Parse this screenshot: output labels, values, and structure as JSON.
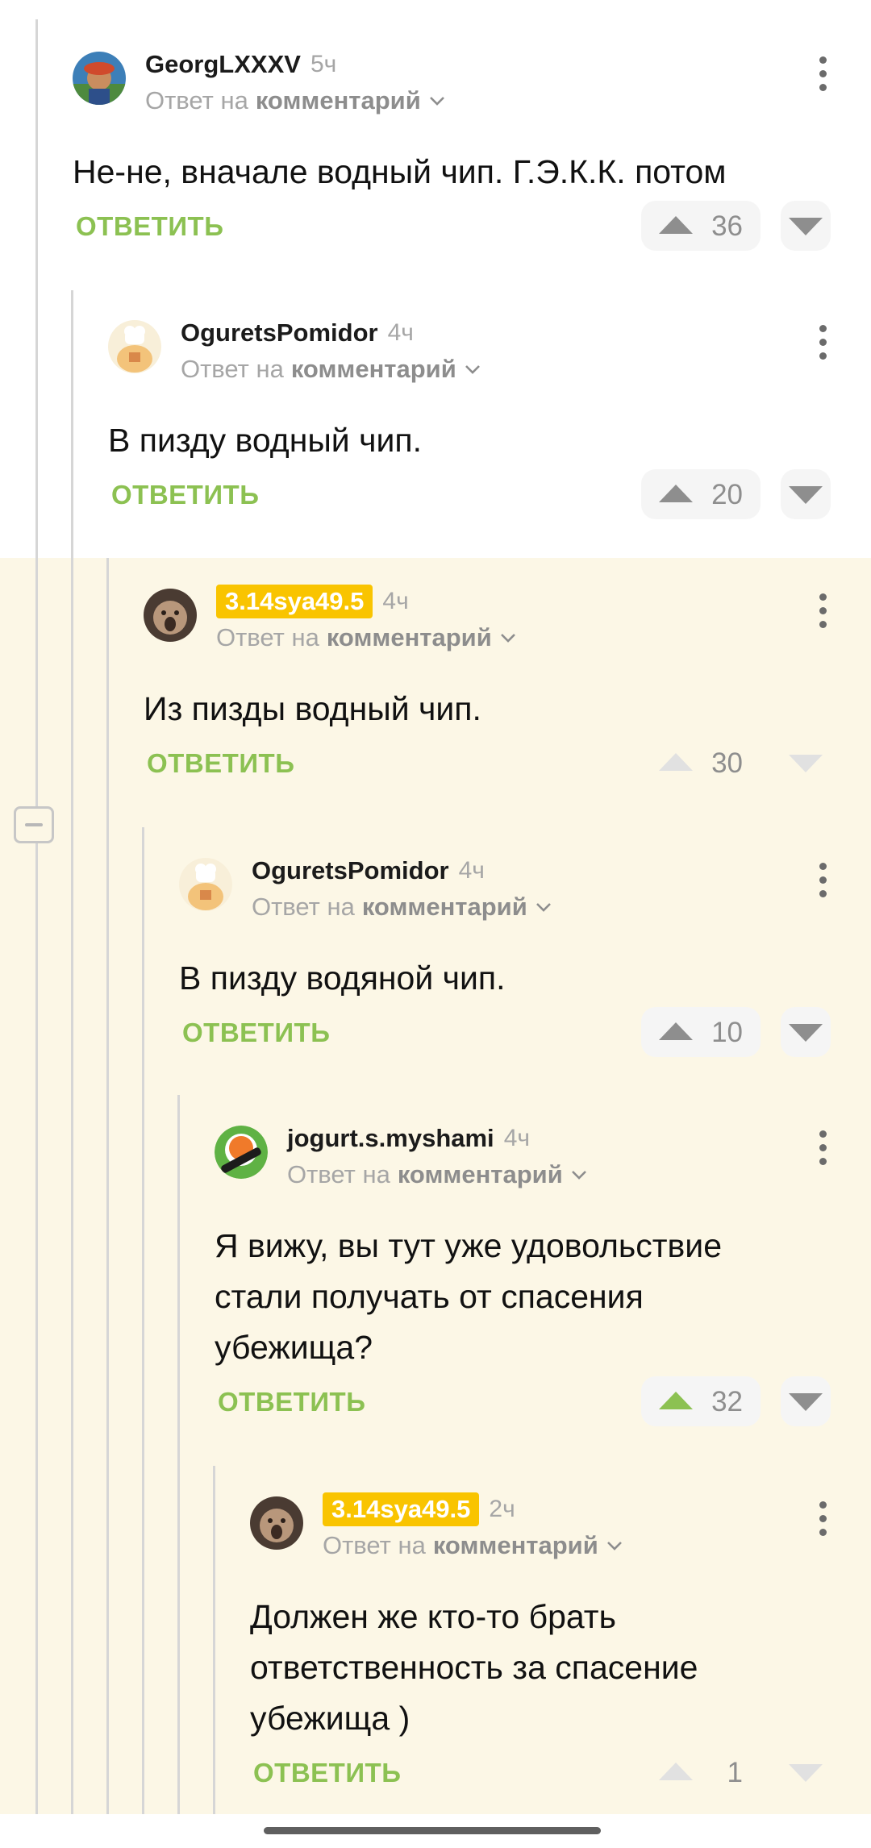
{
  "reply_prefix": "Ответ на",
  "reply_target": "комментарий",
  "reply_action": "ОТВЕТИТЬ",
  "comments": [
    {
      "user": "GeorgLXXXV",
      "time": "5ч",
      "text": "Не-не, вначале водный чип. Г.Э.К.К. потом",
      "votes": "36",
      "avatar": "photo-avatar-hat"
    },
    {
      "user": "OguretsPomidor",
      "time": "4ч",
      "text": "В пизду водный чип.",
      "votes": "20",
      "avatar": "chef-avatar"
    },
    {
      "user": "3.14sya49.5",
      "time": "4ч",
      "text": "Из пизды водный чип.",
      "votes": "30",
      "avatar": "photo-avatar-face",
      "badge_color": "#f9c400"
    },
    {
      "user": "OguretsPomidor",
      "time": "4ч",
      "text": "В пизду водяной чип.",
      "votes": "10",
      "avatar": "chef-avatar"
    },
    {
      "user": "jogurt.s.myshami",
      "time": "4ч",
      "text_lines": [
        "Я вижу, вы тут уже удовольствие",
        "стали получать от спасения",
        "убежища?"
      ],
      "votes": "32",
      "avatar": "sushi-avatar",
      "upvoted": true
    },
    {
      "user": "3.14sya49.5",
      "time": "2ч",
      "text_lines": [
        "Должен же кто-то брать",
        "ответственность за спасение",
        "убежища )"
      ],
      "votes": "1",
      "avatar": "photo-avatar-face",
      "badge_color": "#f9c400"
    }
  ],
  "colors": {
    "accent_green": "#8cc152",
    "badge_yellow": "#f9c400",
    "highlight_background": "#fcf7e6"
  }
}
